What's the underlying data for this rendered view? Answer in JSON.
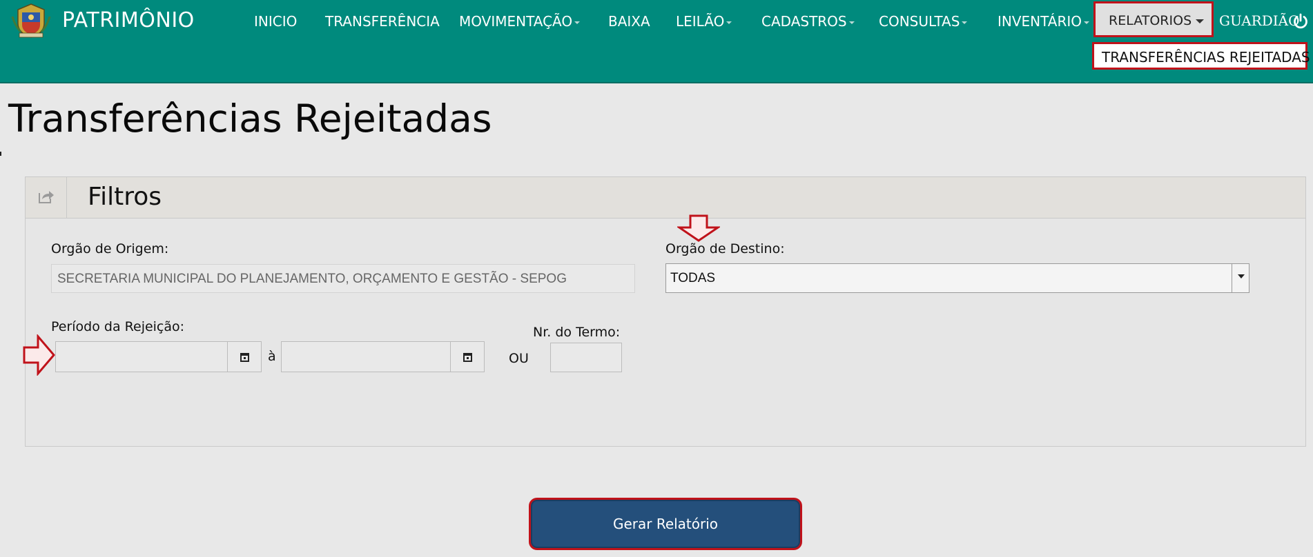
{
  "app": {
    "title": "PATRIMÔNIO"
  },
  "nav": {
    "items": [
      {
        "label": "INICIO",
        "dropdown": false
      },
      {
        "label": "TRANSFERÊNCIA",
        "dropdown": false
      },
      {
        "label": "MOVIMENTAÇÃO",
        "dropdown": true
      },
      {
        "label": "BAIXA",
        "dropdown": false
      },
      {
        "label": "LEILÃO",
        "dropdown": true
      },
      {
        "label": "CADASTROS",
        "dropdown": true
      },
      {
        "label": "CONSULTAS",
        "dropdown": true
      },
      {
        "label": "INVENTÁRIO",
        "dropdown": true
      }
    ],
    "active": {
      "label": "RELATORIOS",
      "highlight_color": "#c0121a"
    },
    "user": "GUARDIÃO",
    "dropdown_items": [
      "TRANSFERÊNCIAS REJEITADAS"
    ]
  },
  "page": {
    "title": "Transferências Rejeitadas"
  },
  "filters": {
    "title": "Filtros",
    "orgao_origem": {
      "label": "Orgão de Origem:",
      "value": "SECRETARIA MUNICIPAL DO PLANEJAMENTO, ORÇAMENTO E GESTÃO - SEPOG"
    },
    "orgao_destino": {
      "label": "Orgão de Destino:",
      "value": "TODAS"
    },
    "periodo": {
      "label": "Período da Rejeição:",
      "separator": "à",
      "start": "",
      "end": ""
    },
    "or_label": "OU",
    "nr_termo": {
      "label": "Nr. do Termo:",
      "value": ""
    }
  },
  "actions": {
    "generate_label": "Gerar Relatório"
  },
  "colors": {
    "navbar": "#008a7d",
    "button": "#244f7b",
    "highlight": "#c0121a"
  }
}
